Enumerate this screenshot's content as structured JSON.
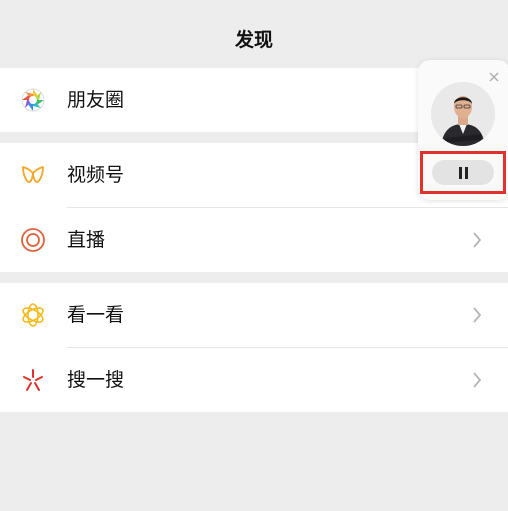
{
  "header": {
    "title": "发现"
  },
  "groups": [
    {
      "items": [
        {
          "label": "朋友圈",
          "icon": "moments-aperture-icon"
        }
      ]
    },
    {
      "items": [
        {
          "label": "视频号",
          "icon": "channels-icon"
        },
        {
          "label": "直播",
          "icon": "live-ring-icon"
        }
      ]
    },
    {
      "items": [
        {
          "label": "看一看",
          "icon": "top-stories-icon"
        },
        {
          "label": "搜一搜",
          "icon": "search-star-icon"
        }
      ]
    }
  ],
  "floating_player": {
    "close_icon": "close-icon",
    "pause_icon": "pause-icon",
    "highlight_color": "#e0312a"
  },
  "colors": {
    "background": "#ededed",
    "channels": "#f5a623",
    "live": "#e0623a",
    "top_stories": "#f2b91b",
    "search": "#e0312a"
  }
}
